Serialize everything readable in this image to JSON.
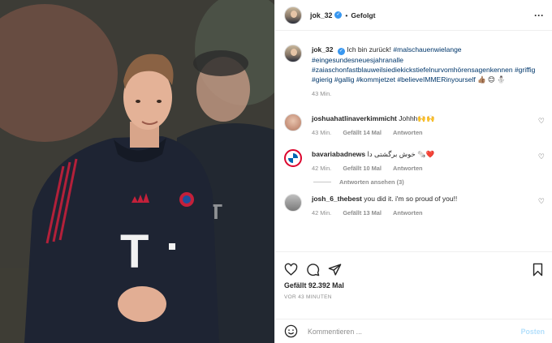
{
  "post": {
    "username": "jok_32",
    "follow_status": "Gefolgt",
    "caption": {
      "text": "Ich bin zurück!",
      "hashtags": "#malschauenwielange #eingesundesneuesjahranalle #zaiaschonfastblauweilsiediekickstiefelnurvomhörensagenkennen #griffig #gierig #gallig #kommjetzet #believeIMMERinyourself",
      "emoji": "👍🏽 😊 ⛄",
      "time": "43 Min."
    },
    "comments": [
      {
        "username": "joshuahatlinaverkimmicht",
        "text": "Johhh🙌🙌",
        "time": "43 Min.",
        "likes": "Gefällt 14 Mal",
        "reply": "Antworten"
      },
      {
        "username": "bavariabadnews",
        "text": "خوش برگشتی دا 🗞️❤️",
        "time": "42 Min.",
        "likes": "Gefällt 10 Mal",
        "reply": "Antworten"
      },
      {
        "username": "josh_6_thebest",
        "text": "you did it. i'm so proud of you!!",
        "time": "42 Min.",
        "likes": "Gefällt 13 Mal",
        "reply": "Antworten"
      }
    ],
    "view_replies": "Antworten ansehen (3)",
    "likes_count": "Gefällt 92.392 Mal",
    "timestamp": "VOR 43 MINUTEN",
    "add_comment_placeholder": "Kommentieren ...",
    "post_button": "Posten",
    "sponsor": "T"
  }
}
